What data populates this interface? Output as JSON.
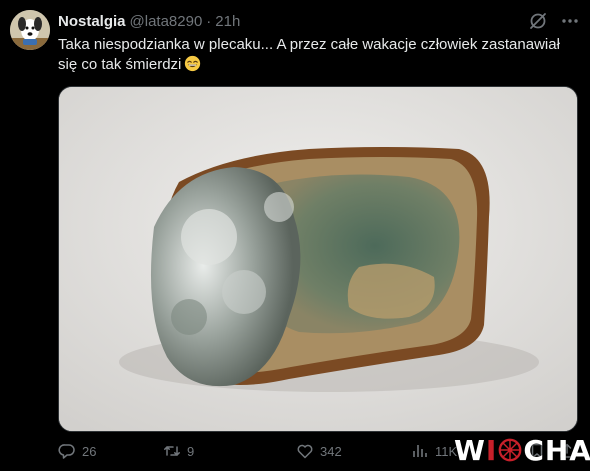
{
  "author": {
    "name": "Nostalgia",
    "handle": "@lata8290",
    "separator": "·",
    "time": "21h",
    "avatar_icon": "dog-cartoon-avatar"
  },
  "header_icons": [
    "grok-icon",
    "more-icon"
  ],
  "tweet": {
    "text": "Taka niespodzianka w plecaku... A przez całe wakacje człowiek zastanawiał się co tak śmierdzi",
    "emoji": "grinning-face-icon"
  },
  "media": {
    "type": "photo",
    "subject": "moldy-bread-slice"
  },
  "actions": {
    "replies": "26",
    "reposts": "9",
    "likes": "342",
    "views": "11K"
  },
  "watermark": {
    "prefix": "W",
    "middle": "I",
    "suffix": "CHA"
  },
  "colors": {
    "background": "#000000",
    "text": "#e7e9ea",
    "secondary": "#71767b",
    "border": "#2f3336",
    "watermark_red": "#c8202a"
  }
}
